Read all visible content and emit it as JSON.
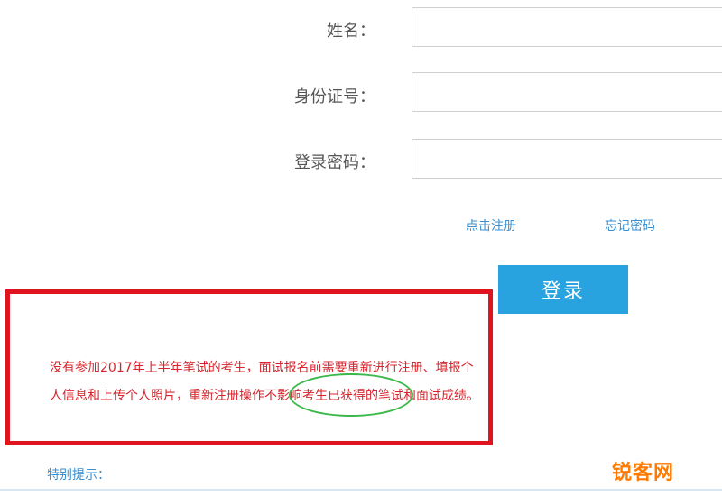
{
  "form": {
    "name_label": "姓名：",
    "id_label": "身份证号：",
    "password_label": "登录密码：",
    "name_value": "",
    "id_value": "",
    "password_value": ""
  },
  "links": {
    "register": "点击注册",
    "forgot": "忘记密码"
  },
  "login_button": "登录",
  "notice": {
    "text_before": "没有参加2017年上半年笔试的考生，面试报名前需要重新进行注册、填报个人信息和上传个人照片，",
    "text_highlight": "重新注册操作不影响",
    "text_after": "考生已获得的笔试和面试成绩。"
  },
  "special_tip": "特别提示：",
  "watermark": "锐客网",
  "colors": {
    "accent": "#29a3df",
    "notice_border": "#e0141e",
    "notice_text": "#d8242c",
    "highlight_ellipse": "#3cb84a",
    "watermark": "#ff7a00"
  }
}
